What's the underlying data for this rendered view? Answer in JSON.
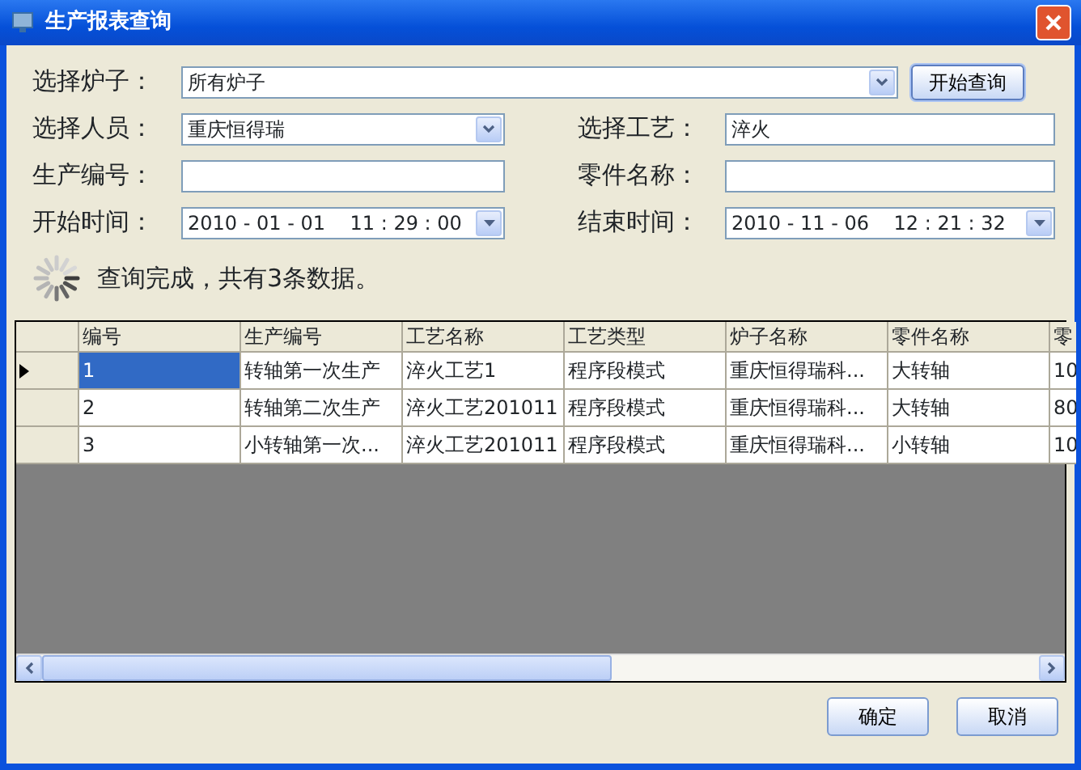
{
  "window": {
    "title": "生产报表查询"
  },
  "form": {
    "rows": [
      [
        {
          "label": "选择炉子：",
          "kind": "combo",
          "value": "所有炉子"
        },
        {
          "kind": "button",
          "label": "开始查询"
        }
      ],
      [
        {
          "label": "选择人员：",
          "kind": "combo",
          "value": "重庆恒得瑞"
        },
        {
          "label": "选择工艺：",
          "kind": "text",
          "value": "淬火"
        }
      ],
      [
        {
          "label": "生产编号：",
          "kind": "text"
        },
        {
          "label": "零件名称：",
          "kind": "text"
        }
      ],
      [
        {
          "label": "开始时间：",
          "kind": "date",
          "value": "2010 - 01 - 01    11 : 29 : 00"
        },
        {
          "label": "结束时间：",
          "kind": "date",
          "value": "2010 - 11 - 06    12 : 21 : 32"
        }
      ]
    ]
  },
  "status": {
    "text": "查询完成，共有3条数据。"
  },
  "table": {
    "columns": [
      "编号",
      "生产编号",
      "工艺名称",
      "工艺类型",
      "炉子名称",
      "零件名称",
      "零"
    ],
    "rows": [
      {
        "selected": true,
        "cells": [
          "1",
          "转轴第一次生产",
          "淬火工艺1",
          "程序段模式",
          "重庆恒得瑞科...",
          "大转轴",
          "10"
        ]
      },
      {
        "selected": false,
        "cells": [
          "2",
          "转轴第二次生产",
          "淬火工艺201011",
          "程序段模式",
          "重庆恒得瑞科...",
          "大转轴",
          "80"
        ]
      },
      {
        "selected": false,
        "cells": [
          "3",
          "小转轴第一次...",
          "淬火工艺201011",
          "程序段模式",
          "重庆恒得瑞科...",
          "小转轴",
          "10"
        ]
      }
    ]
  },
  "buttons": [
    "确定",
    "取消"
  ]
}
